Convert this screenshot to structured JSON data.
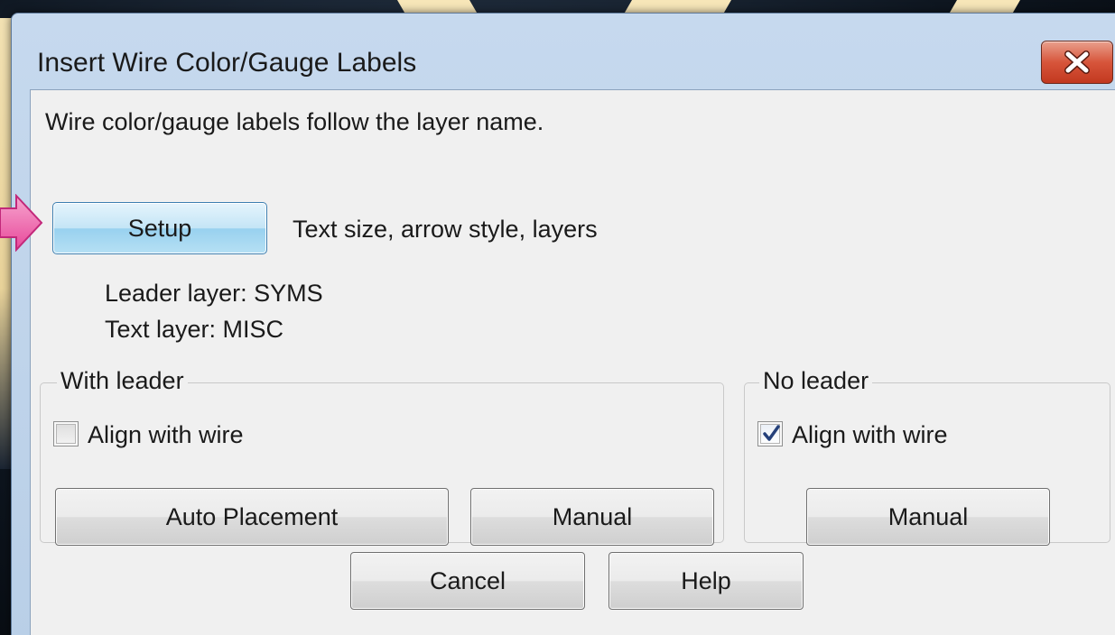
{
  "window": {
    "title": "Insert Wire Color/Gauge Labels",
    "close_icon": "close-x-icon"
  },
  "description": "Wire color/gauge labels follow the layer name.",
  "setup": {
    "button_label": "Setup",
    "hint": "Text size, arrow style, layers"
  },
  "layers": {
    "leader": "Leader layer:  SYMS",
    "text": "Text layer:  MISC"
  },
  "with_leader": {
    "title": "With leader",
    "align_label": "Align with wire",
    "align_checked": false,
    "auto_button": "Auto Placement",
    "manual_button": "Manual"
  },
  "no_leader": {
    "title": "No leader",
    "align_label": "Align with wire",
    "align_checked": true,
    "manual_button": "Manual"
  },
  "footer": {
    "cancel_button": "Cancel",
    "help_button": "Help"
  },
  "colors": {
    "accent_pointer": "#e8489a",
    "setup_highlight": "#98d1ef",
    "close_red": "#c2381f"
  }
}
